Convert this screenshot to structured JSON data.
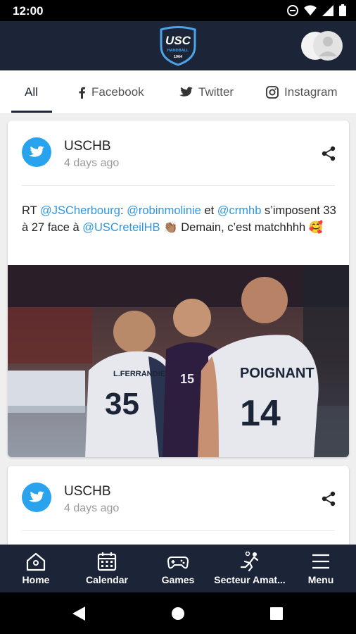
{
  "status_bar": {
    "time": "12:00"
  },
  "header": {
    "logo_text": "USC",
    "logo_subtext": "HANDBALL",
    "logo_year": "1964"
  },
  "tabs": [
    {
      "label": "All",
      "icon": "none",
      "active": true
    },
    {
      "label": "Facebook",
      "icon": "facebook-icon",
      "active": false
    },
    {
      "label": "Twitter",
      "icon": "twitter-icon",
      "active": false
    },
    {
      "label": "Instagram",
      "icon": "instagram-icon",
      "active": false
    }
  ],
  "posts": [
    {
      "author": "USCHB",
      "time": "4 days ago",
      "text": {
        "rt": "RT ",
        "m1": "@JSCherbourg",
        "t1": ": ",
        "m2": "@robinmolinie",
        "t2": " et ",
        "m3": "@crmhb",
        "t3": " s’imposent 33 à 27 face à ",
        "m4": "@USCreteilHB",
        "t4": " 👏🏽 Demain, c’est matchhhh 🥰"
      },
      "photo": {
        "jersey_left_name": "L.FERRANDIER",
        "jersey_left_number": "35",
        "jersey_center_number": "15",
        "jersey_right_name": "POIGNANT",
        "jersey_right_number": "14"
      }
    },
    {
      "author": "USCHB",
      "time": "4 days ago"
    }
  ],
  "bottom_nav": [
    {
      "label": "Home",
      "icon": "home-icon"
    },
    {
      "label": "Calendar",
      "icon": "calendar-icon"
    },
    {
      "label": "Games",
      "icon": "gamepad-icon"
    },
    {
      "label": "Secteur Amat...",
      "icon": "handball-player-icon"
    },
    {
      "label": "Menu",
      "icon": "menu-icon"
    }
  ],
  "colors": {
    "header_bg": "#1c2438",
    "twitter_blue": "#2aa3ef",
    "mention": "#2a97e8"
  }
}
